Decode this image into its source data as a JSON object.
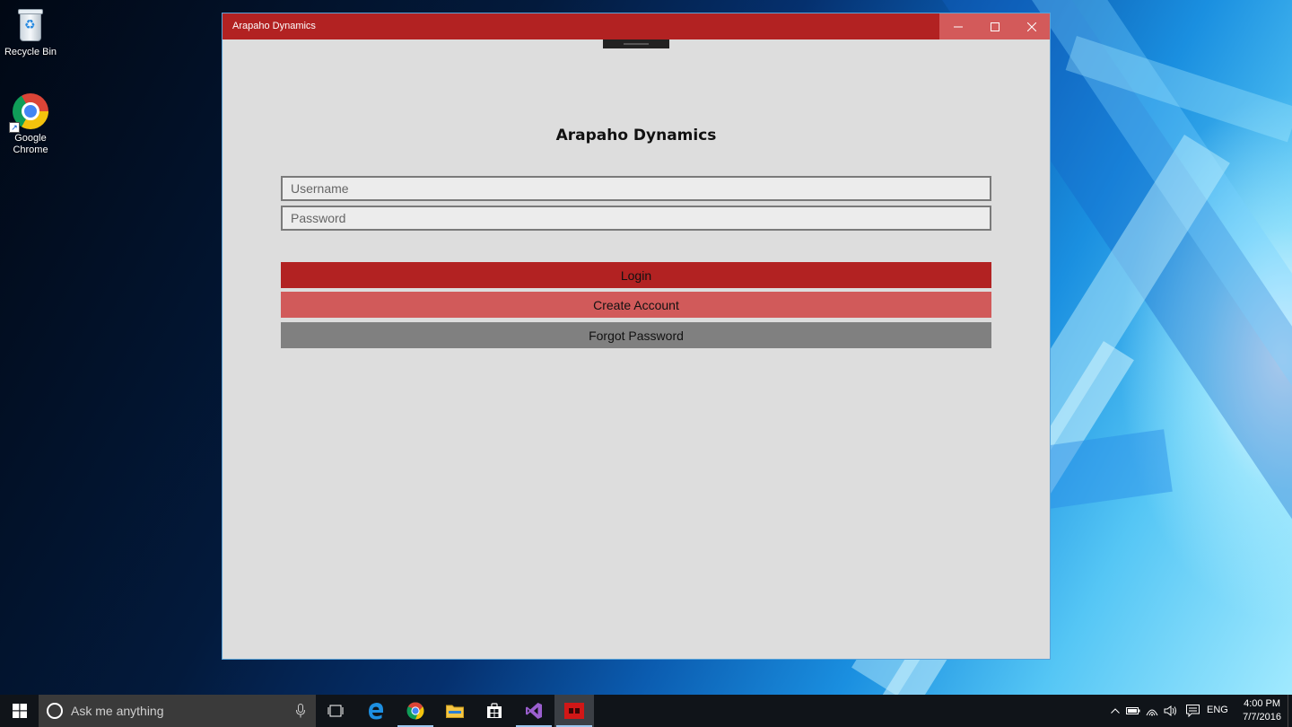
{
  "desktop": {
    "icons": [
      {
        "label": "Recycle Bin",
        "icon": "recycle-bin-icon"
      },
      {
        "label": "Google\nChrome",
        "icon": "chrome-icon"
      }
    ]
  },
  "window": {
    "title": "Arapaho Dynamics",
    "caption_buttons": [
      "minimize",
      "maximize",
      "close"
    ],
    "accent_color": "#b22222"
  },
  "app": {
    "heading": "Arapaho Dynamics",
    "username": {
      "placeholder": "Username",
      "value": ""
    },
    "password": {
      "placeholder": "Password",
      "value": ""
    },
    "buttons": {
      "login": "Login",
      "create_account": "Create Account",
      "forgot_password": "Forgot Password"
    },
    "colors": {
      "login": "#b22222",
      "create_account": "#d15a5a",
      "forgot_password": "#808080",
      "background": "#dddddd"
    }
  },
  "taskbar": {
    "search_placeholder": "Ask me anything",
    "pinned_apps": [
      "task-view",
      "edge",
      "chrome",
      "file-explorer",
      "store",
      "visual-studio",
      "arapaho-dynamics"
    ],
    "language": "ENG",
    "time": "4:00 PM",
    "date": "7/7/2016"
  }
}
